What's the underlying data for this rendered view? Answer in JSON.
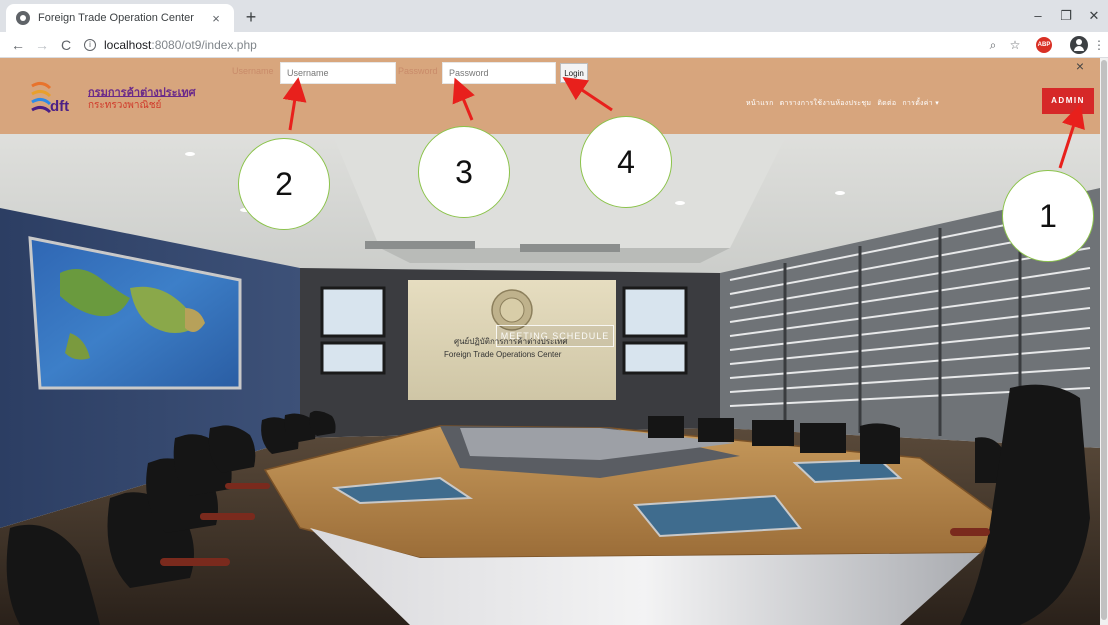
{
  "browser": {
    "tab_title": "Foreign Trade Operation Center",
    "tab_close": "×",
    "new_tab": "+",
    "window": {
      "minimize": "–",
      "restore": "❐",
      "close": "✕"
    },
    "nav": {
      "back": "←",
      "forward": "→",
      "reload": "C"
    },
    "url_host": "localhost",
    "url_path": ":8080/ot9/index.php",
    "ext_badge": "ABP"
  },
  "header": {
    "logo": {
      "brand": "dft",
      "line1": "กรมการค้าต่างประเทศ",
      "line2": "กระทรวงพาณิชย์"
    },
    "login": {
      "username_label": "Username",
      "username_placeholder": "Username",
      "password_label": "Password",
      "password_placeholder": "Password",
      "button": "Login"
    },
    "nav": [
      "หน้าแรก",
      "ตารางการใช้งานห้องประชุม",
      "ติดต่อ",
      "การตั้งค่า ▾"
    ],
    "admin": "ADMIN",
    "close": "×"
  },
  "hero": {
    "meeting_button": "MEETING SCHEDULE",
    "center_name_th": "ศูนย์ปฏิบัติการการค้าต่างประเทศ",
    "center_name_en": "Foreign Trade Operations Center"
  },
  "callouts": [
    "1",
    "2",
    "3",
    "4"
  ],
  "colors": {
    "header_bg": "#d6a074",
    "admin_bg": "#d62828",
    "callout_border": "#8bc34a",
    "arrow": "#e8201c"
  }
}
